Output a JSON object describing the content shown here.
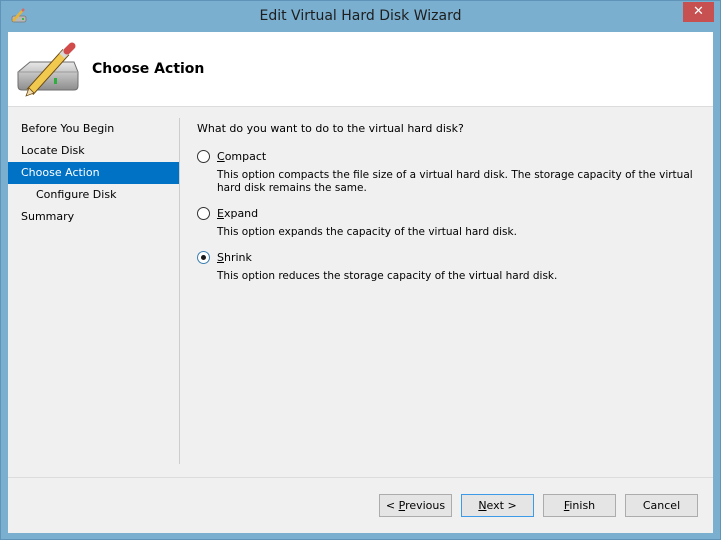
{
  "window": {
    "title": "Edit Virtual Hard Disk Wizard",
    "icon": "disk-pencil-icon",
    "close_label": "✕"
  },
  "header": {
    "title": "Choose Action",
    "icon": "disk-pencil-icon"
  },
  "nav": {
    "items": [
      {
        "label": "Before You Begin",
        "active": false,
        "indent": false
      },
      {
        "label": "Locate Disk",
        "active": false,
        "indent": false
      },
      {
        "label": "Choose Action",
        "active": true,
        "indent": false
      },
      {
        "label": "Configure Disk",
        "active": false,
        "indent": true
      },
      {
        "label": "Summary",
        "active": false,
        "indent": false
      }
    ]
  },
  "content": {
    "question": "What do you want to do to the virtual hard disk?",
    "options": [
      {
        "mnemonic": "C",
        "rest": "ompact",
        "label": "Compact",
        "checked": false,
        "description": "This option compacts the file size of a virtual hard disk. The storage capacity of the virtual hard disk remains the same."
      },
      {
        "mnemonic": "E",
        "rest": "xpand",
        "label": "Expand",
        "checked": false,
        "description": "This option expands the capacity of the virtual hard disk."
      },
      {
        "mnemonic": "S",
        "rest": "hrink",
        "label": "Shrink",
        "checked": true,
        "description": "This option reduces the storage capacity of the virtual hard disk."
      }
    ]
  },
  "buttons": {
    "previous": {
      "pre": "< ",
      "mnemonic": "P",
      "rest": "revious"
    },
    "next": {
      "pre": "",
      "mnemonic": "N",
      "rest": "ext >"
    },
    "finish": {
      "pre": "",
      "mnemonic": "F",
      "rest": "inish"
    },
    "cancel": "Cancel"
  },
  "colors": {
    "frame": "#7aafd0",
    "close": "#c75050",
    "selection": "#0072c6",
    "default_button_border": "#3c9ae8"
  }
}
